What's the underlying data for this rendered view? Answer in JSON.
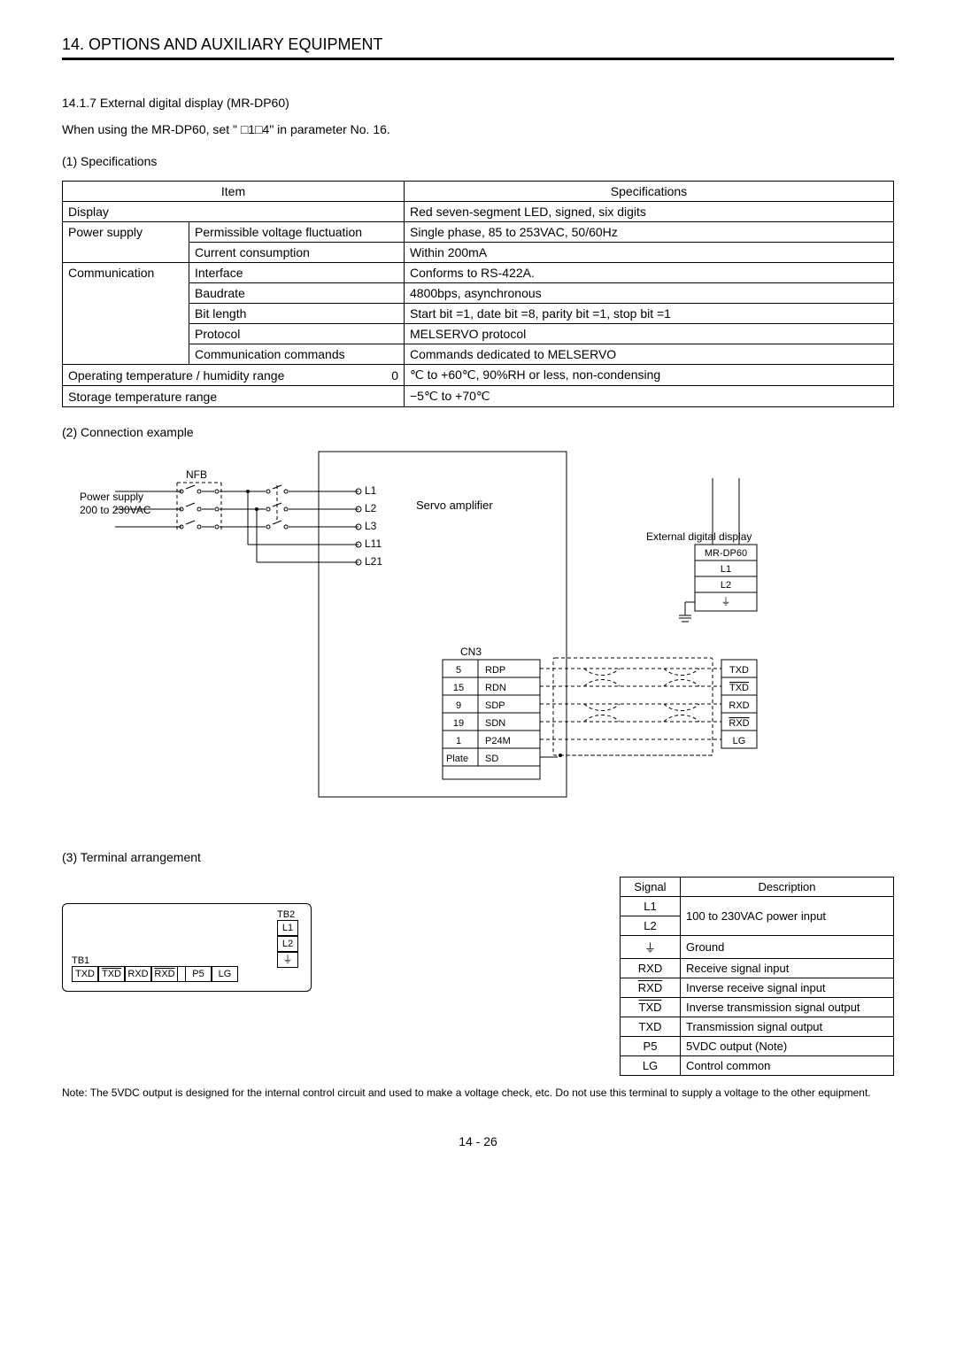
{
  "header": "14. OPTIONS AND AUXILIARY EQUIPMENT",
  "sec1_title": "14.1.7 External digital display (MR-DP60)",
  "sec1_para": "When using the MR-DP60, set \"  □1□4\" in parameter No. 16.",
  "spec_heading": "(1) Specifications",
  "spec_th_item": "Item",
  "spec_th_spec": "Specifications",
  "rows": {
    "display_item": "Display",
    "display_spec": "Red seven-segment LED, signed, six digits",
    "power_item": "Power supply",
    "power_sub1": "Permissible voltage fluctuation",
    "power_spec1": "Single phase, 85 to 253VAC, 50/60Hz",
    "power_sub2": "Current consumption",
    "power_spec2": "Within 200mA",
    "comm_item": "Communication",
    "comm_sub1": "Interface",
    "comm_spec1": "Conforms to RS-422A.",
    "comm_sub2": "Baudrate",
    "comm_spec2": "4800bps, asynchronous",
    "comm_sub3": "Bit length",
    "comm_spec3": "Start bit  =1, date bit =8, parity bit  =1, stop bit =1",
    "comm_sub4": "Protocol",
    "comm_spec4": "MELSERVO protocol",
    "comm_sub5": "Communication commands",
    "comm_spec5": "Commands dedicated to MELSERVO",
    "optemp_item": "Operating temperature / humidity range",
    "optemp_right0": "0",
    "optemp_spec": "℃ to +60℃, 90%RH or less, non-condensing",
    "storage_item": "Storage temperature range",
    "storage_spec": "−5℃ to +70℃"
  },
  "conn_heading": "(2) Connection example",
  "diagram": {
    "nfb": "NFB",
    "ps1": "Power supply",
    "ps2": "200 to 230VAC",
    "servo": "Servo amplifier",
    "ext_label": "External digital display",
    "ext_model": "MR-DP60",
    "cn3": "CN3",
    "L1": "L1",
    "L2": "L2",
    "L3": "L3",
    "L11": "L11",
    "L21": "L21",
    "gnd": "⏚",
    "dp_L1": "L1",
    "dp_L2": "L2",
    "dp_gnd": "⏚",
    "pins": {
      "p5": "5",
      "s5": "RDP",
      "d5": "TXD",
      "p15": "15",
      "s15": "RDN",
      "d15": "TXD",
      "p9": "9",
      "s9": "SDP",
      "d9": "RXD",
      "p19": "19",
      "s19": "SDN",
      "d19": "RXD",
      "p1": "1",
      "s1": "P24M",
      "d1": "LG",
      "pPlate": "Plate",
      "sSD": "SD"
    }
  },
  "term_heading": "(3) Terminal arrangement",
  "tb2": "TB2",
  "tb1": "TB1",
  "tb1_cells": [
    "TXD",
    "TXD",
    "RXD",
    "RXD",
    "P5",
    "LG"
  ],
  "tb2_cells": [
    "L1",
    "L2",
    "⏚"
  ],
  "sigtable": {
    "th1": "Signal",
    "th2": "Description",
    "r1s": "L1",
    "r2s": "L2",
    "r12d": "100 to 230VAC power input",
    "r3s": "⏚",
    "r3d": "Ground",
    "r4s": "RXD",
    "r4d": "Receive signal input",
    "r5s": "RXD",
    "r5d": "Inverse receive signal input",
    "r6s": "TXD",
    "r6d": "Inverse transmission signal output",
    "r7s": "TXD",
    "r7d": "Transmission signal output",
    "r8s": "P5",
    "r8d": "5VDC output  (Note)",
    "r9s": "LG",
    "r9d": "Control common"
  },
  "note": "Note: The 5VDC output is designed for the internal control circuit and used to make a voltage check, etc. Do not use this terminal to supply a voltage to the other equipment.",
  "pagenum": "14  -  26"
}
